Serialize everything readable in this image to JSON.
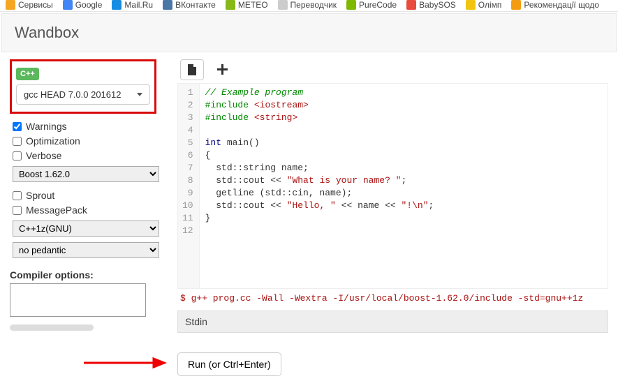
{
  "bookmarks": [
    {
      "label": "Сервисы",
      "color": "#f5a623"
    },
    {
      "label": "Google",
      "color": "#4285f4"
    },
    {
      "label": "Mail.Ru",
      "color": "#168de2"
    },
    {
      "label": "ВКонтакте",
      "color": "#4a76a8"
    },
    {
      "label": "METEO",
      "color": "#86b817"
    },
    {
      "label": "Переводчик",
      "color": "#ccc"
    },
    {
      "label": "PureCode",
      "color": "#7fb800"
    },
    {
      "label": "BabySOS",
      "color": "#e74c3c"
    },
    {
      "label": "Олімп",
      "color": "#f1c40f"
    },
    {
      "label": "Рекомендації щодо",
      "color": "#f39c12"
    }
  ],
  "title": "Wandbox",
  "lang_badge": "C++",
  "compiler_dd": "gcc HEAD 7.0.0 201612",
  "checks": {
    "warnings": {
      "label": "Warnings",
      "checked": true
    },
    "optimization": {
      "label": "Optimization",
      "checked": false
    },
    "verbose": {
      "label": "Verbose",
      "checked": false
    },
    "sprout": {
      "label": "Sprout",
      "checked": false
    },
    "messagepack": {
      "label": "MessagePack",
      "checked": false
    }
  },
  "selects": {
    "boost": "Boost 1.62.0",
    "std": "C++1z(GNU)",
    "pedantic": "no pedantic"
  },
  "compiler_options_label": "Compiler options:",
  "compiler_options_value": "",
  "code_lines": [
    [
      {
        "t": "// Example program",
        "c": "c-comment"
      }
    ],
    [
      {
        "t": "#include",
        "c": "c-pre"
      },
      {
        "t": " "
      },
      {
        "t": "<iostream>",
        "c": "c-string"
      }
    ],
    [
      {
        "t": "#include",
        "c": "c-pre"
      },
      {
        "t": " "
      },
      {
        "t": "<string>",
        "c": "c-string"
      }
    ],
    [],
    [
      {
        "t": "int",
        "c": "c-keyword"
      },
      {
        "t": " main()"
      }
    ],
    [
      {
        "t": "{"
      }
    ],
    [
      {
        "t": "  std::string name;"
      }
    ],
    [
      {
        "t": "  std::cout << "
      },
      {
        "t": "\"What is your name? \"",
        "c": "c-string"
      },
      {
        "t": ";"
      }
    ],
    [
      {
        "t": "  getline (std::cin, name);"
      }
    ],
    [
      {
        "t": "  std::cout << "
      },
      {
        "t": "\"Hello, \"",
        "c": "c-string"
      },
      {
        "t": " << name << "
      },
      {
        "t": "\"!\\n\"",
        "c": "c-string"
      },
      {
        "t": ";"
      }
    ],
    [
      {
        "t": "}"
      }
    ],
    []
  ],
  "cmdline": "$ g++ prog.cc -Wall -Wextra -I/usr/local/boost-1.62.0/include -std=gnu++1z",
  "stdin_label": "Stdin",
  "run_label": "Run (or Ctrl+Enter)"
}
